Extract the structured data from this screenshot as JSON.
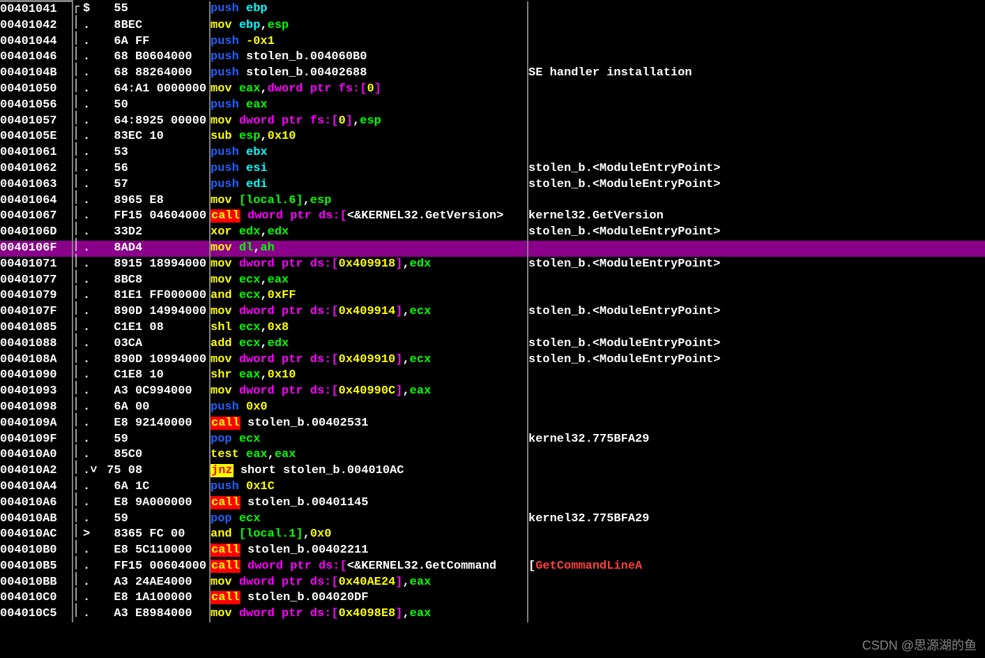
{
  "watermark": "CSDN @思源湖的鱼",
  "rows": [
    {
      "addr": "00401041",
      "mark": "entry",
      "dot": "$",
      "hex": "  55",
      "tokens": [
        [
          "push ",
          "mnem-blue"
        ],
        [
          "ebp",
          "reg-cyan"
        ]
      ],
      "comment": "",
      "top": true
    },
    {
      "addr": "00401042",
      "dot": ".",
      "hex": "  8BEC",
      "tokens": [
        [
          "mov ",
          "mnem-yellow"
        ],
        [
          "ebp",
          "reg-cyan"
        ],
        [
          ",",
          "text"
        ],
        [
          "esp",
          "reg-green"
        ]
      ],
      "comment": ""
    },
    {
      "addr": "00401044",
      "dot": ".",
      "hex": "  6A FF",
      "tokens": [
        [
          "push ",
          "mnem-blue"
        ],
        [
          "-0x1",
          "num"
        ]
      ],
      "comment": ""
    },
    {
      "addr": "00401046",
      "dot": ".",
      "hex": "  68 B0604000",
      "tokens": [
        [
          "push ",
          "mnem-blue"
        ],
        [
          "stolen_b.004060B0",
          "text"
        ]
      ],
      "comment": ""
    },
    {
      "addr": "0040104B",
      "dot": ".",
      "hex": "  68 88264000",
      "tokens": [
        [
          "push ",
          "mnem-blue"
        ],
        [
          "stolen_b.00402688",
          "text"
        ]
      ],
      "comment": "SE handler installation"
    },
    {
      "addr": "00401050",
      "dot": ".",
      "hex": "  64:A1 0000000",
      "tokens": [
        [
          "mov ",
          "mnem-yellow"
        ],
        [
          "eax",
          "reg-green"
        ],
        [
          ",",
          "text"
        ],
        [
          "dword ptr fs:[",
          "memptr"
        ],
        [
          "0",
          "num"
        ],
        [
          "]",
          "memptr"
        ]
      ],
      "comment": ""
    },
    {
      "addr": "00401056",
      "dot": ".",
      "hex": "  50",
      "tokens": [
        [
          "push ",
          "mnem-blue"
        ],
        [
          "eax",
          "reg-green"
        ]
      ],
      "comment": ""
    },
    {
      "addr": "00401057",
      "dot": ".",
      "hex": "  64:8925 00000",
      "tokens": [
        [
          "mov ",
          "mnem-yellow"
        ],
        [
          "dword ptr fs:[",
          "memptr"
        ],
        [
          "0",
          "num"
        ],
        [
          "]",
          "memptr"
        ],
        [
          ",",
          "text"
        ],
        [
          "esp",
          "reg-green"
        ]
      ],
      "comment": ""
    },
    {
      "addr": "0040105E",
      "dot": ".",
      "hex": "  83EC 10",
      "tokens": [
        [
          "sub ",
          "mnem-yellow"
        ],
        [
          "esp",
          "reg-green"
        ],
        [
          ",",
          "text"
        ],
        [
          "0x10",
          "num"
        ]
      ],
      "comment": ""
    },
    {
      "addr": "00401061",
      "dot": ".",
      "hex": "  53",
      "tokens": [
        [
          "push ",
          "mnem-blue"
        ],
        [
          "ebx",
          "reg-cyan"
        ]
      ],
      "comment": ""
    },
    {
      "addr": "00401062",
      "dot": ".",
      "hex": "  56",
      "tokens": [
        [
          "push ",
          "mnem-blue"
        ],
        [
          "esi",
          "reg-cyan"
        ]
      ],
      "comment": "stolen_b.<ModuleEntryPoint>"
    },
    {
      "addr": "00401063",
      "dot": ".",
      "hex": "  57",
      "tokens": [
        [
          "push ",
          "mnem-blue"
        ],
        [
          "edi",
          "reg-cyan"
        ]
      ],
      "comment": "stolen_b.<ModuleEntryPoint>"
    },
    {
      "addr": "00401064",
      "dot": ".",
      "hex": "  8965 E8",
      "tokens": [
        [
          "mov ",
          "mnem-yellow"
        ],
        [
          "[",
          "local"
        ],
        [
          "local.6",
          "local"
        ],
        [
          "]",
          "local"
        ],
        [
          ",",
          "text"
        ],
        [
          "esp",
          "reg-green"
        ]
      ],
      "comment": ""
    },
    {
      "addr": "00401067",
      "dot": ".",
      "hex": "  FF15 04604000",
      "tokens": [
        [
          "call",
          "call"
        ],
        [
          " ",
          "text"
        ],
        [
          "dword ptr ds:[",
          "memptr"
        ],
        [
          "<&KERNEL32.GetVersion",
          "text"
        ],
        [
          ">",
          "text"
        ]
      ],
      "comment": "kernel32.GetVersion"
    },
    {
      "addr": "0040106D",
      "dot": ".",
      "hex": "  33D2",
      "tokens": [
        [
          "xor ",
          "mnem-yellow"
        ],
        [
          "edx",
          "reg-green"
        ],
        [
          ",",
          "text"
        ],
        [
          "edx",
          "reg-green"
        ]
      ],
      "comment": "stolen_b.<ModuleEntryPoint>"
    },
    {
      "addr": "0040106F",
      "dot": ".",
      "hex": "  8AD4",
      "tokens": [
        [
          "mov ",
          "mnem-yellow"
        ],
        [
          "dl",
          "reg-green"
        ],
        [
          ",",
          "text"
        ],
        [
          "ah",
          "reg-green"
        ]
      ],
      "comment": "",
      "selected": true
    },
    {
      "addr": "00401071",
      "dot": ".",
      "hex": "  8915 18994000",
      "tokens": [
        [
          "mov ",
          "mnem-yellow"
        ],
        [
          "dword ptr ds:[",
          "memptr"
        ],
        [
          "0x409918",
          "num"
        ],
        [
          "]",
          "memptr"
        ],
        [
          ",",
          "text"
        ],
        [
          "edx",
          "reg-green"
        ]
      ],
      "comment": "stolen_b.<ModuleEntryPoint>"
    },
    {
      "addr": "00401077",
      "dot": ".",
      "hex": "  8BC8",
      "tokens": [
        [
          "mov ",
          "mnem-yellow"
        ],
        [
          "ecx",
          "reg-green"
        ],
        [
          ",",
          "text"
        ],
        [
          "eax",
          "reg-green"
        ]
      ],
      "comment": ""
    },
    {
      "addr": "00401079",
      "dot": ".",
      "hex": "  81E1 FF000000",
      "tokens": [
        [
          "and ",
          "mnem-yellow"
        ],
        [
          "ecx",
          "reg-green"
        ],
        [
          ",",
          "text"
        ],
        [
          "0xFF",
          "num"
        ]
      ],
      "comment": ""
    },
    {
      "addr": "0040107F",
      "dot": ".",
      "hex": "  890D 14994000",
      "tokens": [
        [
          "mov ",
          "mnem-yellow"
        ],
        [
          "dword ptr ds:[",
          "memptr"
        ],
        [
          "0x409914",
          "num"
        ],
        [
          "]",
          "memptr"
        ],
        [
          ",",
          "text"
        ],
        [
          "ecx",
          "reg-green"
        ]
      ],
      "comment": "stolen_b.<ModuleEntryPoint>"
    },
    {
      "addr": "00401085",
      "dot": ".",
      "hex": "  C1E1 08",
      "tokens": [
        [
          "shl ",
          "mnem-yellow"
        ],
        [
          "ecx",
          "reg-green"
        ],
        [
          ",",
          "text"
        ],
        [
          "0x8",
          "num"
        ]
      ],
      "comment": ""
    },
    {
      "addr": "00401088",
      "dot": ".",
      "hex": "  03CA",
      "tokens": [
        [
          "add ",
          "mnem-yellow"
        ],
        [
          "ecx",
          "reg-green"
        ],
        [
          ",",
          "text"
        ],
        [
          "edx",
          "reg-green"
        ]
      ],
      "comment": "stolen_b.<ModuleEntryPoint>"
    },
    {
      "addr": "0040108A",
      "dot": ".",
      "hex": "  890D 10994000",
      "tokens": [
        [
          "mov ",
          "mnem-yellow"
        ],
        [
          "dword ptr ds:[",
          "memptr"
        ],
        [
          "0x409910",
          "num"
        ],
        [
          "]",
          "memptr"
        ],
        [
          ",",
          "text"
        ],
        [
          "ecx",
          "reg-green"
        ]
      ],
      "comment": "stolen_b.<ModuleEntryPoint>"
    },
    {
      "addr": "00401090",
      "dot": ".",
      "hex": "  C1E8 10",
      "tokens": [
        [
          "shr ",
          "mnem-yellow"
        ],
        [
          "eax",
          "reg-green"
        ],
        [
          ",",
          "text"
        ],
        [
          "0x10",
          "num"
        ]
      ],
      "comment": ""
    },
    {
      "addr": "00401093",
      "dot": ".",
      "hex": "  A3 0C994000",
      "tokens": [
        [
          "mov ",
          "mnem-yellow"
        ],
        [
          "dword ptr ds:[",
          "memptr"
        ],
        [
          "0x40990C",
          "num"
        ],
        [
          "]",
          "memptr"
        ],
        [
          ",",
          "text"
        ],
        [
          "eax",
          "reg-green"
        ]
      ],
      "comment": ""
    },
    {
      "addr": "00401098",
      "dot": ".",
      "hex": "  6A 00",
      "tokens": [
        [
          "push ",
          "mnem-blue"
        ],
        [
          "0x0",
          "num"
        ]
      ],
      "comment": ""
    },
    {
      "addr": "0040109A",
      "dot": ".",
      "hex": "  E8 92140000",
      "tokens": [
        [
          "call",
          "call"
        ],
        [
          " ",
          "text"
        ],
        [
          "stolen_b.00402531",
          "text"
        ]
      ],
      "comment": ""
    },
    {
      "addr": "0040109F",
      "dot": ".",
      "hex": "  59",
      "tokens": [
        [
          "pop ",
          "mnem-blue"
        ],
        [
          "ecx",
          "reg-green"
        ]
      ],
      "comment": "kernel32.775BFA29"
    },
    {
      "addr": "004010A0",
      "dot": ".",
      "hex": "  85C0",
      "tokens": [
        [
          "test ",
          "mnem-yellow"
        ],
        [
          "eax",
          "reg-green"
        ],
        [
          ",",
          "text"
        ],
        [
          "eax",
          "reg-green"
        ]
      ],
      "comment": ""
    },
    {
      "addr": "004010A2",
      "dot": ".˅",
      "hex": " 75 08",
      "tokens": [
        [
          "jnz",
          "jnz"
        ],
        [
          " ",
          "text"
        ],
        [
          "short stolen_b.004010AC",
          "text"
        ]
      ],
      "comment": ""
    },
    {
      "addr": "004010A4",
      "dot": ".",
      "hex": "  6A 1C",
      "tokens": [
        [
          "push ",
          "mnem-blue"
        ],
        [
          "0x1C",
          "num"
        ]
      ],
      "comment": ""
    },
    {
      "addr": "004010A6",
      "dot": ".",
      "hex": "  E8 9A000000",
      "tokens": [
        [
          "call",
          "call"
        ],
        [
          " ",
          "text"
        ],
        [
          "stolen_b.00401145",
          "text"
        ]
      ],
      "comment": ""
    },
    {
      "addr": "004010AB",
      "dot": ".",
      "hex": "  59",
      "tokens": [
        [
          "pop ",
          "mnem-blue"
        ],
        [
          "ecx",
          "reg-green"
        ]
      ],
      "comment": "kernel32.775BFA29"
    },
    {
      "addr": "004010AC",
      "dot": ">",
      "hex": "  8365 FC 00",
      "tokens": [
        [
          "and ",
          "mnem-yellow"
        ],
        [
          "[",
          "local"
        ],
        [
          "local.1",
          "local"
        ],
        [
          "]",
          "local"
        ],
        [
          ",",
          "text"
        ],
        [
          "0x0",
          "num"
        ]
      ],
      "comment": ""
    },
    {
      "addr": "004010B0",
      "dot": ".",
      "hex": "  E8 5C110000",
      "tokens": [
        [
          "call",
          "call"
        ],
        [
          " ",
          "text"
        ],
        [
          "stolen_b.00402211",
          "text"
        ]
      ],
      "comment": ""
    },
    {
      "addr": "004010B5",
      "dot": ".",
      "hex": "  FF15 00604000",
      "tokens": [
        [
          "call",
          "call"
        ],
        [
          " ",
          "text"
        ],
        [
          "dword ptr ds:[",
          "memptr"
        ],
        [
          "<&KERNEL32.GetCommand",
          "text"
        ]
      ],
      "comment": "GetCommandLineA",
      "comment_style": "red-bracket"
    },
    {
      "addr": "004010BB",
      "dot": ".",
      "hex": "  A3 24AE4000",
      "tokens": [
        [
          "mov ",
          "mnem-yellow"
        ],
        [
          "dword ptr ds:[",
          "memptr"
        ],
        [
          "0x40AE24",
          "num"
        ],
        [
          "]",
          "memptr"
        ],
        [
          ",",
          "text"
        ],
        [
          "eax",
          "reg-green"
        ]
      ],
      "comment": ""
    },
    {
      "addr": "004010C0",
      "dot": ".",
      "hex": "  E8 1A100000",
      "tokens": [
        [
          "call",
          "call"
        ],
        [
          " ",
          "text"
        ],
        [
          "stolen_b.004020DF",
          "text"
        ]
      ],
      "comment": ""
    },
    {
      "addr": "004010C5",
      "dot": ".",
      "hex": "  A3 E8984000",
      "tokens": [
        [
          "mov ",
          "mnem-yellow"
        ],
        [
          "dword ptr ds:[",
          "memptr"
        ],
        [
          "0x4098E8",
          "num"
        ],
        [
          "]",
          "memptr"
        ],
        [
          ",",
          "text"
        ],
        [
          "eax",
          "reg-green"
        ]
      ],
      "comment": ""
    }
  ]
}
